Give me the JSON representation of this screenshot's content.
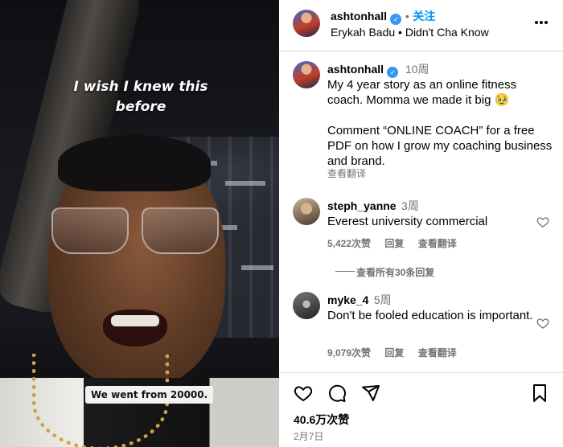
{
  "video": {
    "caption_top": "I wish I knew this before",
    "caption_bottom": "We went from 20000."
  },
  "header": {
    "username": "ashtonhall",
    "follow_label": "关注",
    "separator": "•",
    "audio": "Erykah Badu • Didn't Cha Know",
    "more_icon": "more-horizontal-icon"
  },
  "post": {
    "username": "ashtonhall",
    "time": "10周",
    "caption_line1": "My 4 year story as an online fitness coach. Momma we made it big 🥹",
    "caption_line2": "Comment “ONLINE COACH” for a free PDF on how I grow my coaching business and brand.",
    "see_translation": "查看翻译"
  },
  "comments": [
    {
      "username": "steph_yanne",
      "time": "3周",
      "text": "Everest university commercial",
      "likes": "5,422次赞",
      "reply": "回复",
      "translate": "查看翻译"
    },
    {
      "username": "myke_4",
      "time": "5周",
      "text": "Don't be fooled education is important.",
      "likes": "9,079次赞",
      "reply": "回复",
      "translate": "查看翻译"
    }
  ],
  "view_replies": "查看所有30条回复",
  "actions": {
    "likes": "40.6万次赞",
    "date": "2月7日"
  },
  "colors": {
    "accent": "#0095f6",
    "verified": "#3897f0",
    "muted": "#737373",
    "divider": "#dbdbdb"
  }
}
